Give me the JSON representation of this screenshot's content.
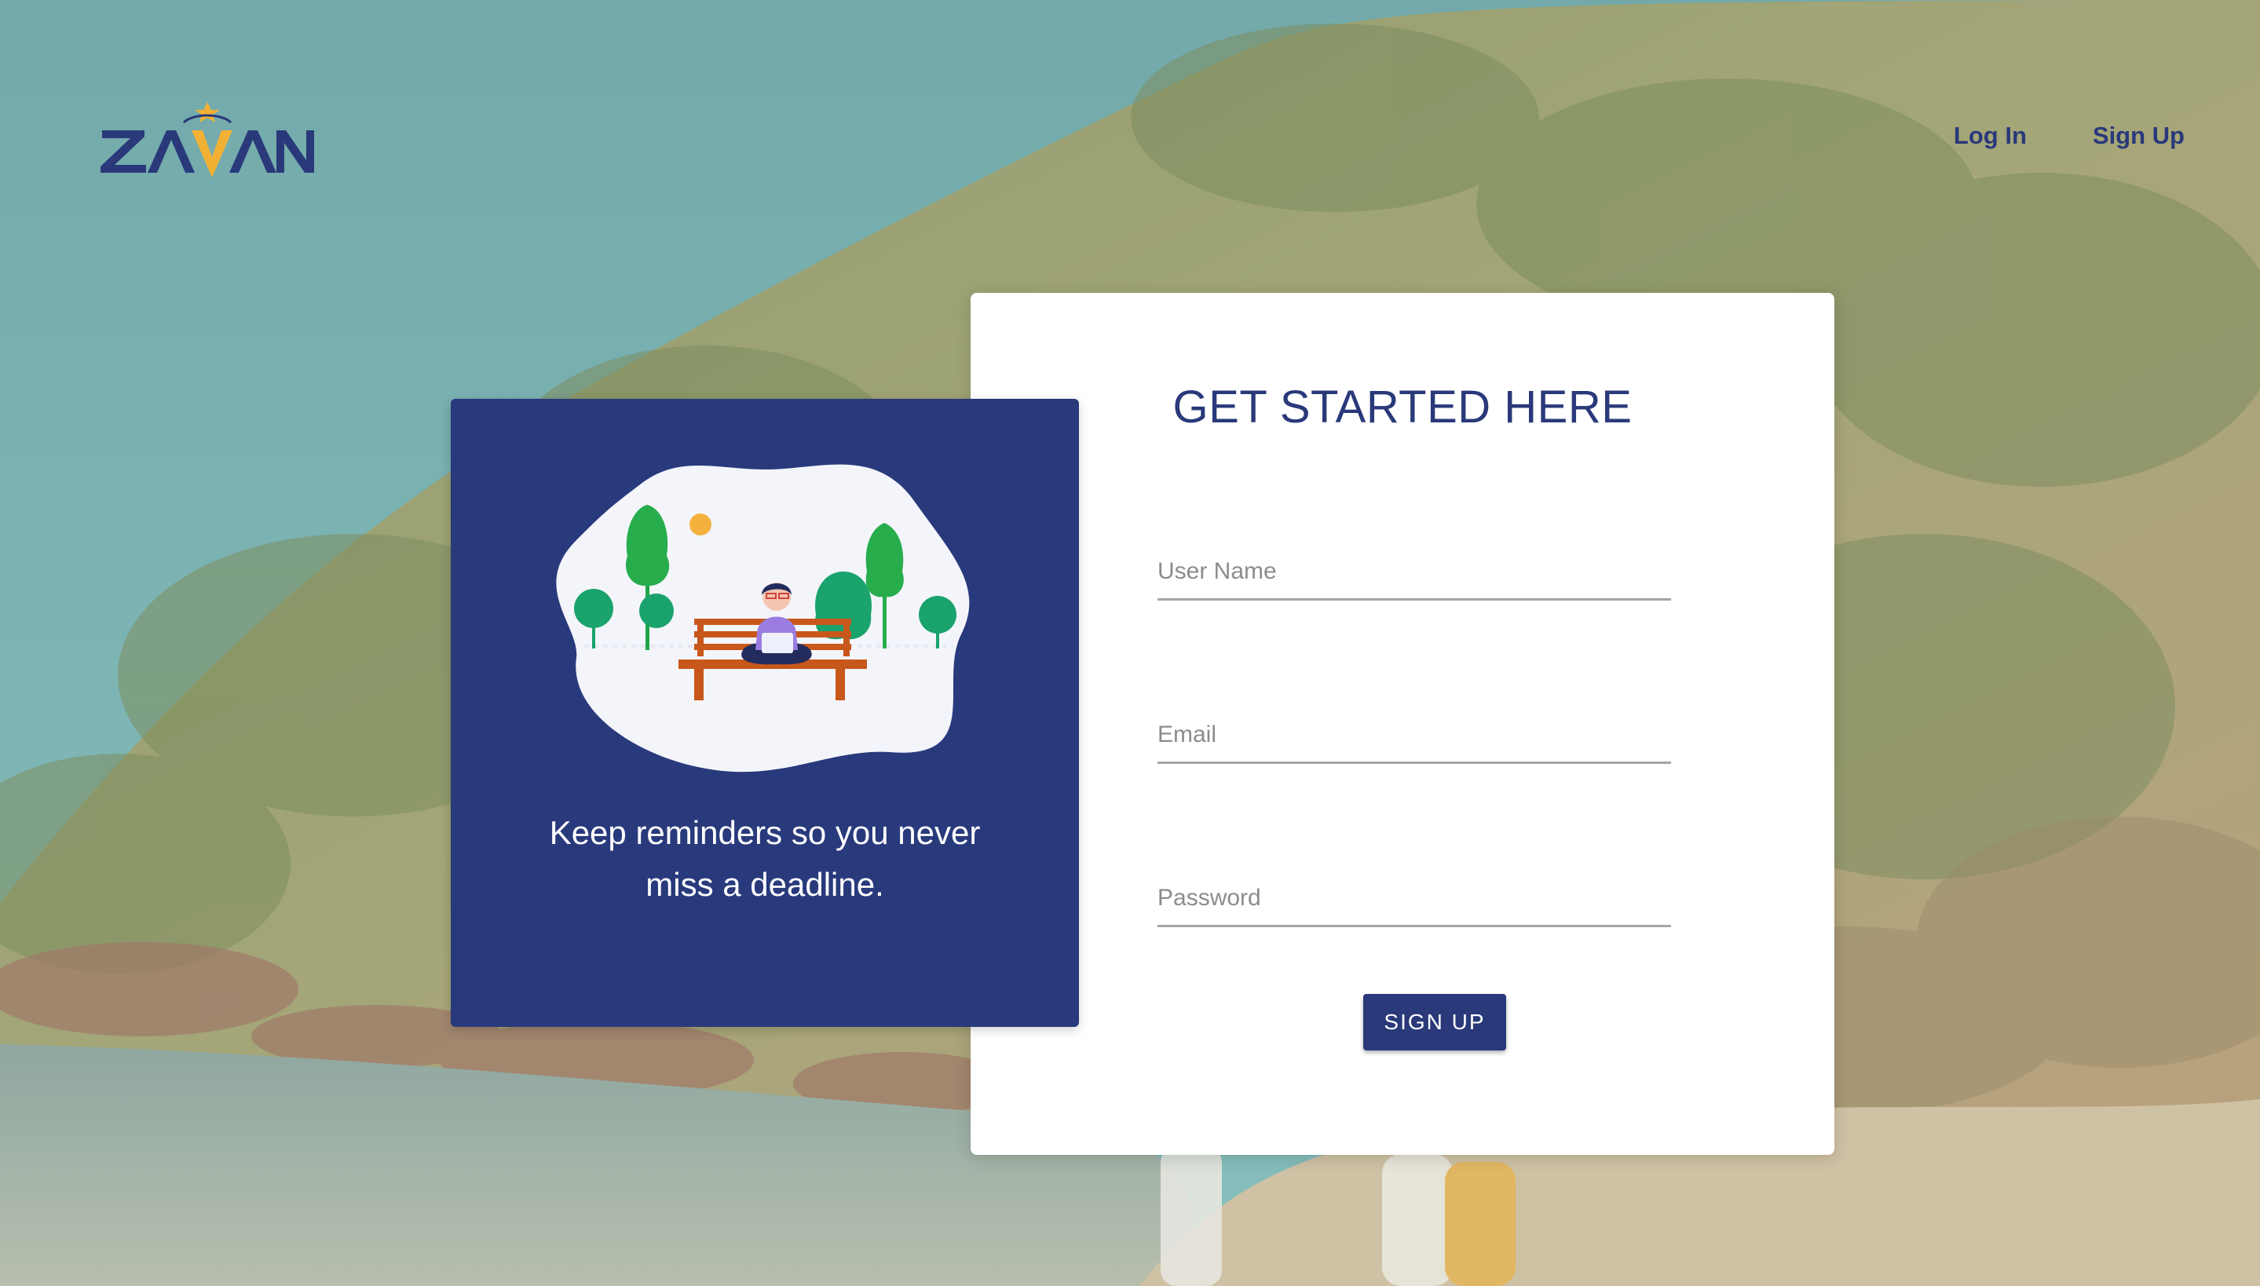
{
  "nav": {
    "login_label": "Log In",
    "signup_label": "Sign Up"
  },
  "logo": {
    "text": "ZAVAN"
  },
  "info_card": {
    "text": "Keep reminders so you never miss a deadline."
  },
  "form": {
    "title": "GET STARTED HERE",
    "username_placeholder": "User Name",
    "email_placeholder": "Email",
    "password_placeholder": "Password",
    "submit_label": "SIGN UP"
  },
  "colors": {
    "brand_navy": "#29397a",
    "brand_gold": "#f2b134",
    "card_blue": "#293a7c"
  },
  "icons": {
    "logo": "zavan-logo-icon",
    "illustration": "person-on-bench-illustration"
  }
}
